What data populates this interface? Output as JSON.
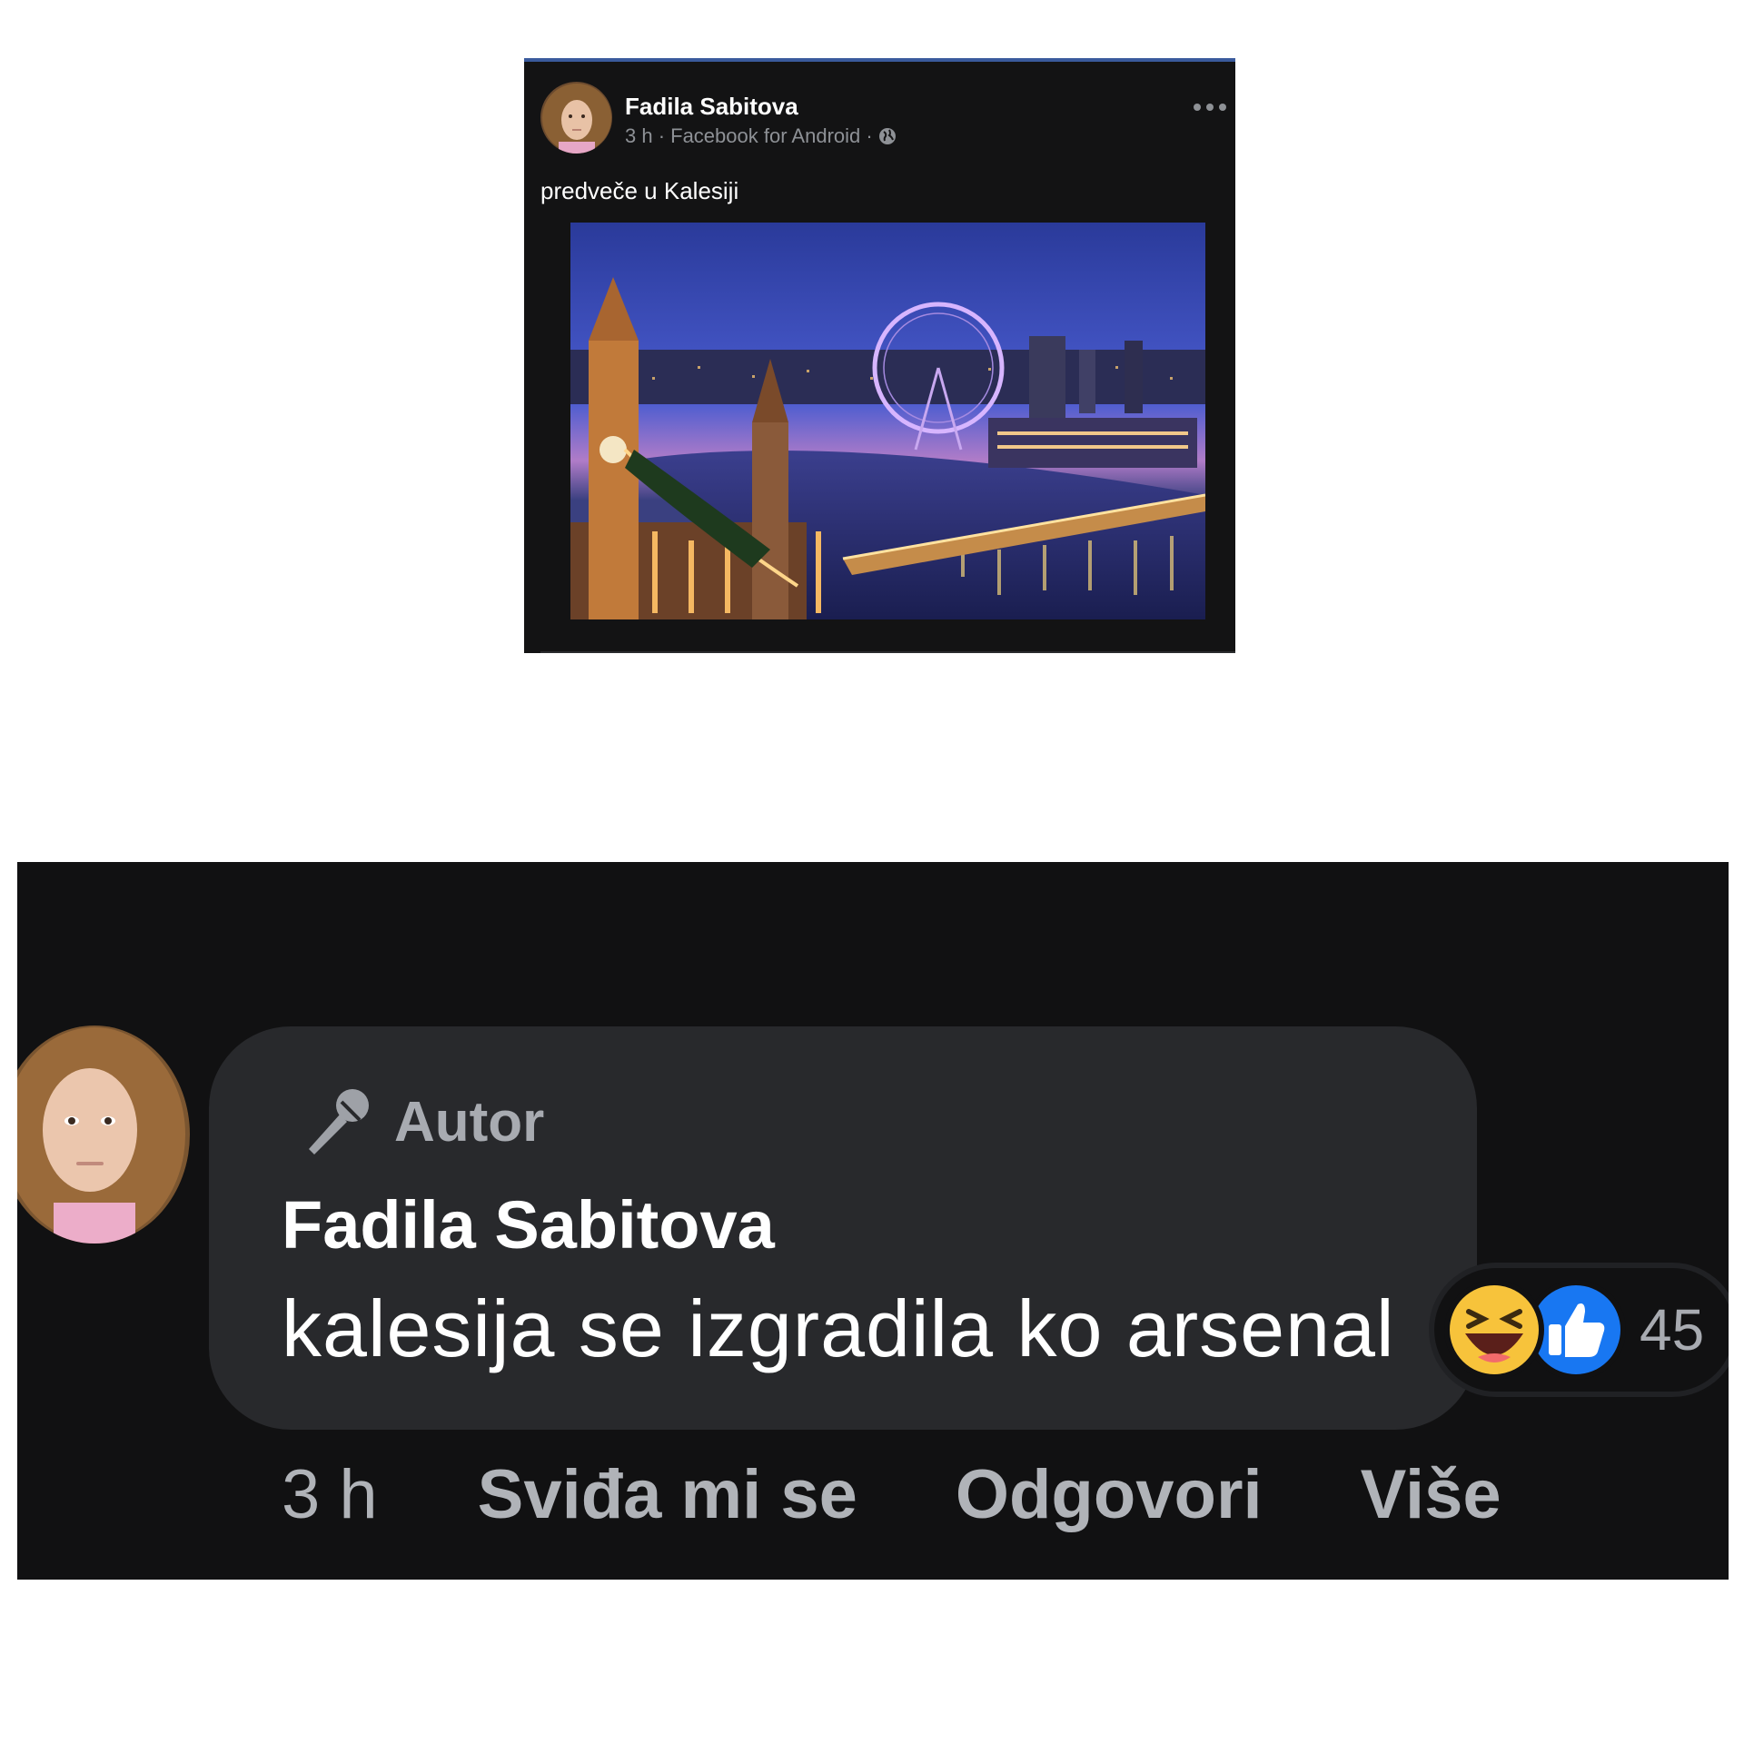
{
  "post": {
    "author": "Fadila Sabitova",
    "meta": "3 h · Facebook for Android ·",
    "privacy_icon": "globe-icon",
    "more_icon": "more-dots-icon",
    "text": "predveče u Kalesiji"
  },
  "comment": {
    "badge_icon": "microphone-icon",
    "badge_label": "Autor",
    "author": "Fadila Sabitova",
    "text": "kalesija se izgradila ko arsenal",
    "reactions": {
      "icons": [
        "haha-emoji-icon",
        "like-thumb-icon"
      ],
      "count": "45"
    },
    "actions": {
      "time": "3 h",
      "like": "Sviđa mi se",
      "reply": "Odgovori",
      "more": "Više"
    }
  },
  "colors": {
    "post_bg": "#131314",
    "comment_bg": "#111112",
    "bubble_bg": "#28292c",
    "muted_text": "#a8abb1",
    "like_blue": "#1877f2",
    "haha_yellow": "#f7c33b"
  }
}
